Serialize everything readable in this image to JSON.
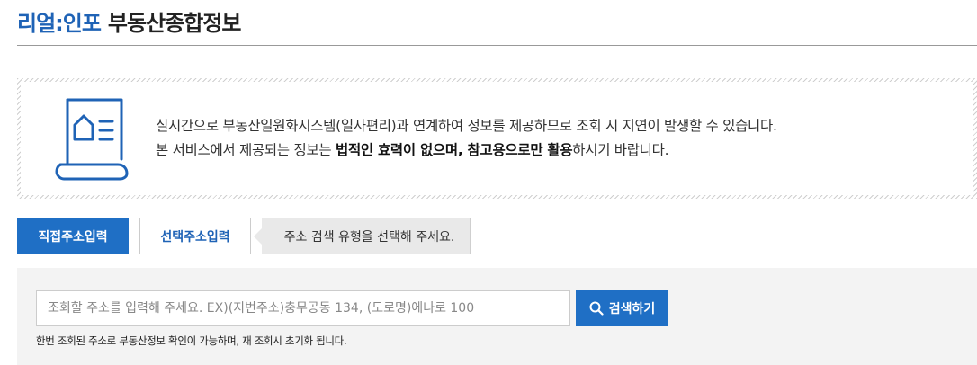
{
  "header": {
    "brand": "리얼:인포",
    "subtitle": "부동산종합정보"
  },
  "notice": {
    "icon": "document-home-icon",
    "line1": "실시간으로 부동산일원화시스템(일사편리)과 연계하여 정보를 제공하므로 조회 시 지연이 발생할 수 있습니다.",
    "line2_prefix": "본 서비스에서 제공되는 정보는 ",
    "line2_bold1": "법적인 효력이 없으며, 참고용으로만 활용",
    "line2_suffix": "하시기 바랍니다."
  },
  "tabs": {
    "direct": "직접주소입력",
    "select": "선택주소입력",
    "hint": "주소 검색 유형을 선택해 주세요."
  },
  "search": {
    "placeholder": "조회할 주소를 입력해 주세요. EX)(지번주소)충무공동 134, (도로명)에나로 100",
    "value": "",
    "button_label": "검색하기",
    "note": "한번 조회된 주소로 부동산정보 확인이 가능하며, 재 조회시 초기화 됩니다."
  },
  "colors": {
    "accent": "#1f6fc5",
    "brand": "#1f63b6"
  }
}
